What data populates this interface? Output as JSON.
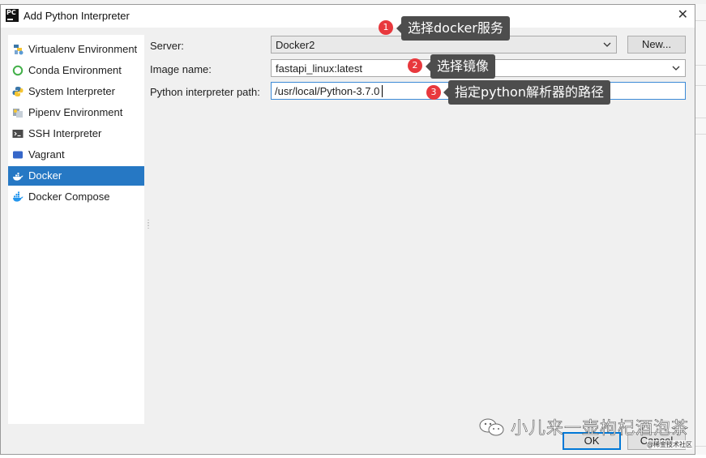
{
  "dialog": {
    "title": "Add Python Interpreter",
    "app_icon_text": "PC",
    "close_symbol": "✕"
  },
  "sidebar": {
    "items": [
      {
        "label": "Virtualenv Environment",
        "icon": "virtualenv-icon"
      },
      {
        "label": "Conda Environment",
        "icon": "conda-icon"
      },
      {
        "label": "System Interpreter",
        "icon": "python-icon"
      },
      {
        "label": "Pipenv Environment",
        "icon": "pipenv-icon"
      },
      {
        "label": "SSH Interpreter",
        "icon": "terminal-icon"
      },
      {
        "label": "Vagrant",
        "icon": "vagrant-icon"
      },
      {
        "label": "Docker",
        "icon": "docker-icon",
        "selected": true
      },
      {
        "label": "Docker Compose",
        "icon": "docker-compose-icon"
      }
    ]
  },
  "form": {
    "server_label": "Server:",
    "server_value": "Docker2",
    "new_button": "New...",
    "image_label": "Image name:",
    "image_value": "fastapi_linux:latest",
    "path_label": "Python interpreter path:",
    "path_value": "/usr/local/Python-3.7.0"
  },
  "annotations": [
    {
      "number": "1",
      "text": "选择docker服务"
    },
    {
      "number": "2",
      "text": "选择镜像"
    },
    {
      "number": "3",
      "text": "指定python解析器的路径"
    }
  ],
  "buttons": {
    "ok": "OK",
    "cancel": "Cancel"
  },
  "watermark": {
    "text": "小儿来一壶枸杞酒泡茶",
    "small": "@稀金技术社区"
  },
  "colors": {
    "selection": "#2678c4",
    "badge": "#e8383d",
    "tooltip": "#4d4d4d",
    "focus": "#3c8ad6"
  }
}
